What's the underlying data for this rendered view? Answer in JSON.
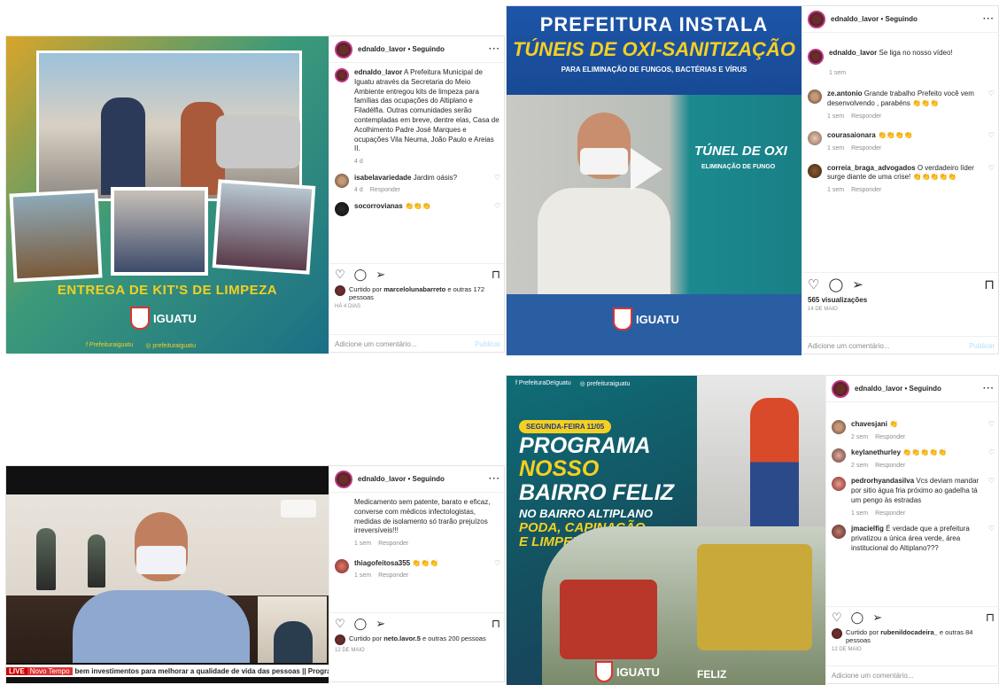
{
  "posts": [
    {
      "username": "ednaldo_lavor",
      "follow": "Seguindo",
      "caption": "A Prefeitura Municipal de Iguatu através da Secretaria do Meio Ambiente entregou kits de limpeza para famílias das ocupações do Altiplano e Filadélfia. Outras comunidades serão contempladas em breve, dentre elas, Casa de Acolhimento Padre José Marques e ocupações Vila Neuma, João Paulo e Areias II.",
      "caption_time": "4 d",
      "image_banner": "ENTREGA DE KIT'S DE LIMPEZA",
      "image_logo": "IGUATU",
      "image_footer_fb": "Prefeituraiguatu",
      "image_footer_ig": "prefeituraiguatu",
      "comments": [
        {
          "user": "isabelavariedade",
          "text": "Jardim oásis?",
          "time": "4 d",
          "reply": "Responder"
        },
        {
          "user": "socorrovianas",
          "text": "👏👏👏",
          "time": "",
          "reply": ""
        }
      ],
      "liked_prefix": "Curtido por",
      "liked_user": "marcelolunabarreto",
      "liked_rest": "e outras 172 pessoas",
      "date": "HÁ 4 DIAS",
      "add_comment": "Adicione um comentário...",
      "publish": "Publicar"
    },
    {
      "username": "ednaldo_lavor",
      "follow": "Seguindo",
      "caption": "Se liga no nosso vídeo!",
      "caption_time": "1 sem",
      "image_title1": "PREFEITURA INSTALA",
      "image_title2": "TÚNEIS DE OXI-SANITIZAÇÃO",
      "image_title3": "PARA ELIMINAÇÃO DE FUNGOS, BACTÉRIAS E VÍRUS",
      "image_sign": "TÚNEL DE OXI",
      "image_sign2": "ELIMINAÇÃO DE FUNGO",
      "image_logo": "IGUATU",
      "comments": [
        {
          "user": "ze.antonio",
          "text": "Grande trabalho Prefeito você vem desenvolvendo , parabéns 👏👏👏",
          "time": "1 sem",
          "reply": "Responder"
        },
        {
          "user": "courasaionara",
          "text": "👏👏👏👏",
          "time": "1 sem",
          "reply": "Responder"
        },
        {
          "user": "correia_braga_advogados",
          "text": "O verdadeiro líder surge diante de uma crise! 👏👏👏👏👏",
          "time": "1 sem",
          "reply": "Responder"
        }
      ],
      "views": "565 visualizações",
      "date": "14 DE MAIO",
      "add_comment": "Adicione um comentário...",
      "publish": "Publicar"
    },
    {
      "username": "ednaldo_lavor",
      "follow": "Seguindo",
      "caption": "Medicamento sem patente, barato e eficaz, converse com médicos infectologistas, medidas de isolamento só trarão prejuízos irreversíveis!!!",
      "caption_time": "1 sem",
      "caption_reply": "Responder",
      "ticker_live": "LIVE",
      "ticker_label": "Novo Tempo",
      "ticker_text": "bem investimentos para melhorar a qualidade de vida das pessoas || Programa N",
      "comments": [
        {
          "user": "thiagofeitosa355",
          "text": "👏👏👏",
          "time": "1 sem",
          "reply": "Responder"
        }
      ],
      "liked_prefix": "Curtido por",
      "liked_user": "neto.lavor.5",
      "liked_rest": "e outras 200 pessoas",
      "date": "12 DE MAIO"
    },
    {
      "username": "ednaldo_lavor",
      "follow": "Seguindo",
      "image_header_fb": "PrefeituraDeIguatu",
      "image_header_ig": "prefeituraiguatu",
      "image_date": "SEGUNDA-FEIRA 11/05",
      "image_line1": "PROGRAMA",
      "image_line2": "NOSSO",
      "image_line3": "BAIRRO FELIZ",
      "image_line4": "NO BAIRRO ALTIPLANO",
      "image_line5": "PODA, CAPINAÇÃO",
      "image_line6": "E LIMPEZA",
      "image_logo": "IGUATU",
      "image_badge": "FELIZ",
      "comments": [
        {
          "user": "chavesjani",
          "text": "👏",
          "time": "2 sem",
          "reply": "Responder"
        },
        {
          "user": "keylanethurley",
          "text": "👏👏👏👏👏",
          "time": "2 sem",
          "reply": "Responder"
        },
        {
          "user": "pedrorhyandasilva",
          "text": "Vcs deviam mandar por sitio água fria próximo ao gadelha tá um pengo às estradas",
          "time": "1 sem",
          "reply": "Responder"
        },
        {
          "user": "jmacielfig",
          "text": "É verdade que a prefeitura privatizou a única área verde, área institucional do Altiplano???",
          "time": "",
          "reply": ""
        }
      ],
      "liked_prefix": "Curtido por",
      "liked_user": "rubenildocadeira_",
      "liked_rest": "e outras 84 pessoas",
      "date": "12 DE MAIO",
      "add_comment": "Adicione um comentário..."
    }
  ],
  "colors": {
    "ig_blue": "#0095f6",
    "banner_yellow": "#f5d020",
    "teal": "#1b7f83",
    "navy": "#1d3a8a"
  }
}
